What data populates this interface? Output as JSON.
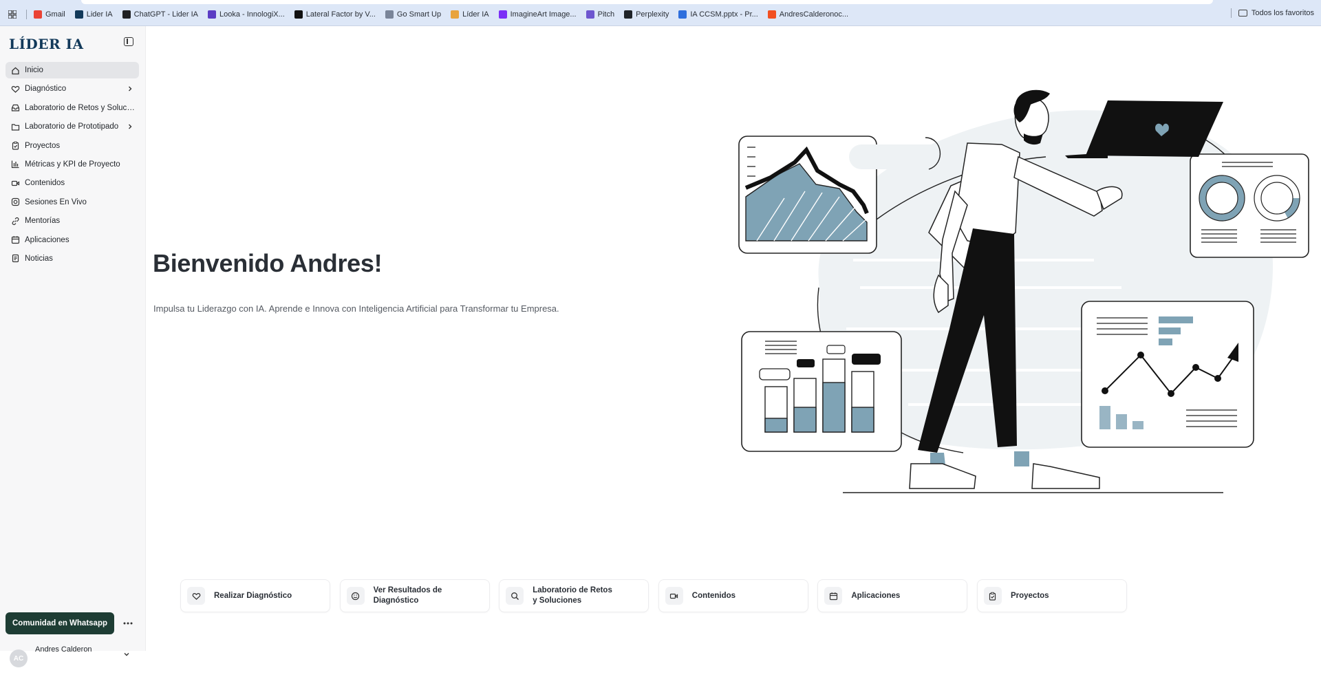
{
  "bookmarks": {
    "items": [
      {
        "label": "Gmail",
        "color": "#ea4335"
      },
      {
        "label": "Lider IA",
        "color": "#12395a"
      },
      {
        "label": "ChatGPT - Lider IA",
        "color": "#202123"
      },
      {
        "label": "Looka - InnologiX...",
        "color": "#5b3cc4"
      },
      {
        "label": "Lateral Factor by V...",
        "color": "#111111"
      },
      {
        "label": "Go Smart Up",
        "color": "#7a8599"
      },
      {
        "label": "Líder IA",
        "color": "#e8a33d"
      },
      {
        "label": "ImagineArt Image...",
        "color": "#7b2ff7"
      },
      {
        "label": "Pitch",
        "color": "#6e56cf"
      },
      {
        "label": "Perplexity",
        "color": "#1f2328"
      },
      {
        "label": "IA CCSM.pptx - Pr...",
        "color": "#2f6fdd"
      },
      {
        "label": "AndresCalderonoc...",
        "color": "#f25022"
      }
    ],
    "all_favorites": "Todos los favoritos"
  },
  "sidebar": {
    "logo": "LÍDER IA",
    "items": [
      {
        "label": "Inicio",
        "icon": "home-icon",
        "active": true
      },
      {
        "label": "Diagnóstico",
        "icon": "heart-icon",
        "chevron": true
      },
      {
        "label": "Laboratorio de Retos y Soluciones",
        "icon": "inbox-icon"
      },
      {
        "label": "Laboratorio de Prototipado",
        "icon": "folder-icon",
        "chevron": true
      },
      {
        "label": "Proyectos",
        "icon": "clipboard-check-icon"
      },
      {
        "label": "Métricas y KPI de Proyecto",
        "icon": "bar-chart-icon"
      },
      {
        "label": "Contenidos",
        "icon": "video-icon"
      },
      {
        "label": "Sesiones En Vivo",
        "icon": "camera-icon"
      },
      {
        "label": "Mentorías",
        "icon": "link-icon"
      },
      {
        "label": "Aplicaciones",
        "icon": "calendar-icon"
      },
      {
        "label": "Noticias",
        "icon": "document-icon"
      }
    ],
    "whatsapp_label": "Comunidad en Whatsapp",
    "user": {
      "name": "Andres Calderon",
      "initials": "AC"
    }
  },
  "main": {
    "welcome": "Bienvenido Andres!",
    "subtitle": "Impulsa tu Liderazgo con IA. Aprende e Innova con Inteligencia Artificial para Transformar tu Empresa."
  },
  "cards": [
    {
      "label": "Realizar Diagnóstico",
      "icon": "heart-icon"
    },
    {
      "label": "Ver Resultados de Diagnóstico",
      "icon": "smile-icon"
    },
    {
      "label": "Laboratorio de Retos\ny Soluciones",
      "icon": "search-icon"
    },
    {
      "label": "Contenidos",
      "icon": "video-icon"
    },
    {
      "label": "Aplicaciones",
      "icon": "calendar-icon"
    },
    {
      "label": "Proyectos",
      "icon": "clipboard-check-icon"
    }
  ],
  "colors": {
    "accent_dark_green": "#1e3d34",
    "logo_navy": "#12395a",
    "illustration_blue": "#7fa3b5",
    "sidebar_bg": "#f7f7f8"
  }
}
